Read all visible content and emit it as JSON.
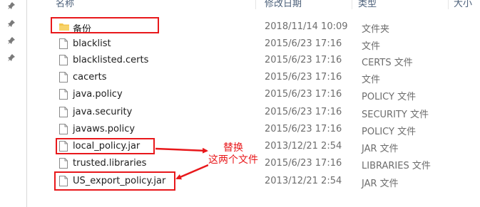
{
  "header": {
    "col_name": "名称",
    "col_date": "修改日期",
    "col_type": "类型",
    "col_size": "大小"
  },
  "files": [
    {
      "name": "备份",
      "date": "2018/11/14 10:09",
      "type": "文件夹",
      "icon": "folder-icon"
    },
    {
      "name": "blacklist",
      "date": "2015/6/23 17:16",
      "type": "文件",
      "icon": "file-icon"
    },
    {
      "name": "blacklisted.certs",
      "date": "2015/6/23 17:16",
      "type": "CERTS 文件",
      "icon": "file-icon"
    },
    {
      "name": "cacerts",
      "date": "2015/6/23 17:16",
      "type": "文件",
      "icon": "file-icon"
    },
    {
      "name": "java.policy",
      "date": "2015/6/23 17:16",
      "type": "POLICY 文件",
      "icon": "file-icon"
    },
    {
      "name": "java.security",
      "date": "2015/6/23 17:16",
      "type": "SECURITY 文件",
      "icon": "file-icon"
    },
    {
      "name": "javaws.policy",
      "date": "2015/6/23 17:16",
      "type": "POLICY 文件",
      "icon": "file-icon"
    },
    {
      "name": "local_policy.jar",
      "date": "2013/12/21 2:54",
      "type": "JAR 文件",
      "icon": "file-icon"
    },
    {
      "name": "trusted.libraries",
      "date": "2015/6/23 17:16",
      "type": "LIBRARIES 文件",
      "icon": "file-icon"
    },
    {
      "name": "US_export_policy.jar",
      "date": "2013/12/21 2:54",
      "type": "JAR 文件",
      "icon": "file-icon"
    }
  ],
  "annotation": {
    "line1": "替换",
    "line2": "这两个文件",
    "color": "#e8181b"
  },
  "colors": {
    "folder": "#f4c64f",
    "highlight": "#e8181b",
    "pin": "#7a7a7a"
  }
}
